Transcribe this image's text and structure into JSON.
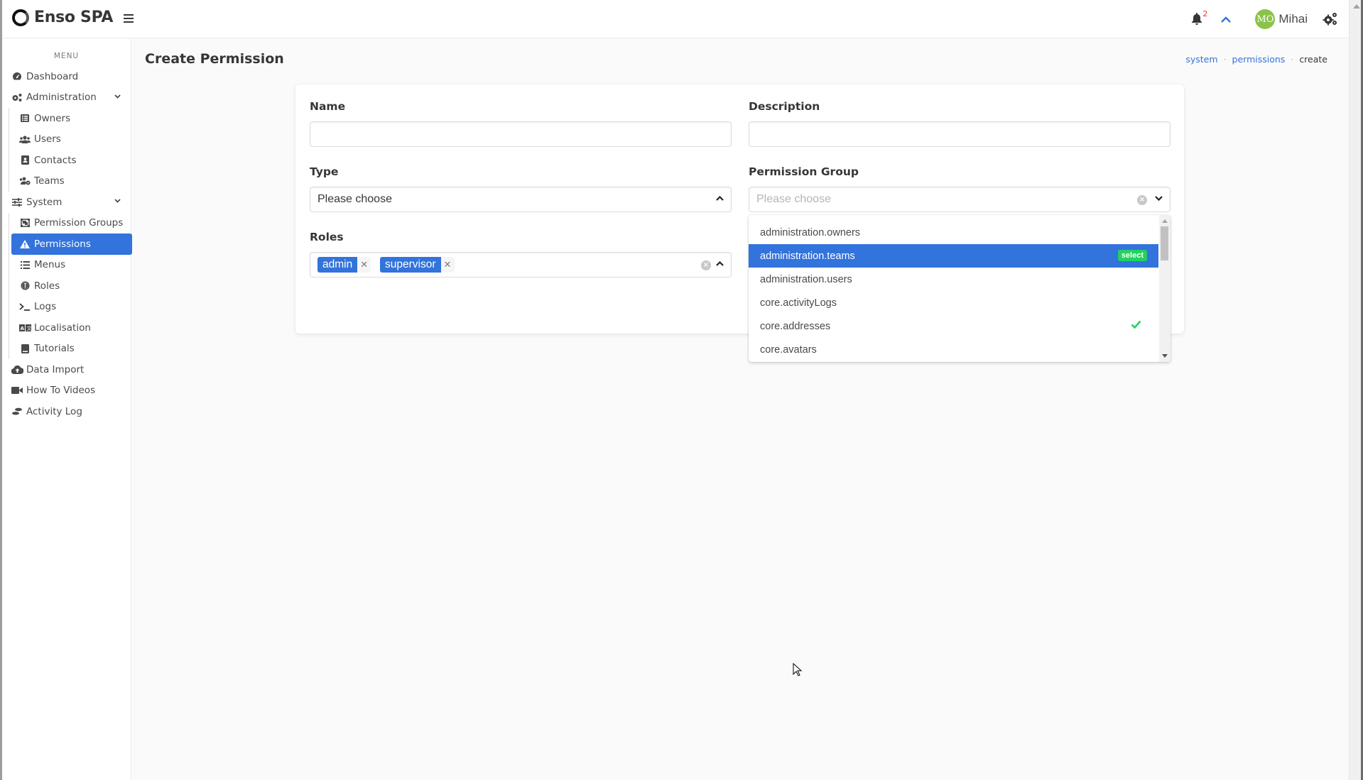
{
  "app": {
    "title": "Enso SPA"
  },
  "header": {
    "notifications_count": "2",
    "user": {
      "initials": "MO",
      "name": "Mihai"
    },
    "colors": {
      "avatar": "#8bc34a",
      "accent": "#3273dc",
      "badge": "#ff2b2b"
    }
  },
  "sidebar": {
    "menu_label": "MENU",
    "items": [
      {
        "label": "Dashboard",
        "icon": "tachometer-icon"
      },
      {
        "label": "Administration",
        "icon": "cogs-icon",
        "expanded": true,
        "children": [
          {
            "label": "Owners",
            "icon": "table-list-icon"
          },
          {
            "label": "Users",
            "icon": "users-icon"
          },
          {
            "label": "Contacts",
            "icon": "address-card-icon"
          },
          {
            "label": "Teams",
            "icon": "users-cog-icon"
          }
        ]
      },
      {
        "label": "System",
        "icon": "sliders-icon",
        "expanded": true,
        "children": [
          {
            "label": "Permission Groups",
            "icon": "object-group-icon"
          },
          {
            "label": "Permissions",
            "icon": "warning-icon",
            "active": true
          },
          {
            "label": "Menus",
            "icon": "list-icon"
          },
          {
            "label": "Roles",
            "icon": "user-circle-icon"
          },
          {
            "label": "Logs",
            "icon": "terminal-icon"
          },
          {
            "label": "Localisation",
            "icon": "language-icon"
          },
          {
            "label": "Tutorials",
            "icon": "book-icon"
          }
        ]
      },
      {
        "label": "Data Import",
        "icon": "cloud-upload-icon"
      },
      {
        "label": "How To Videos",
        "icon": "video-icon"
      },
      {
        "label": "Activity Log",
        "icon": "shoe-prints-icon"
      }
    ]
  },
  "page": {
    "title": "Create Permission",
    "breadcrumb": [
      {
        "label": "system",
        "link": true
      },
      {
        "label": "permissions",
        "link": true
      },
      {
        "label": "create",
        "link": false
      }
    ]
  },
  "form": {
    "name": {
      "label": "Name",
      "value": ""
    },
    "description": {
      "label": "Description",
      "value": ""
    },
    "type": {
      "label": "Type",
      "value": "Please choose"
    },
    "permission_group": {
      "label": "Permission Group",
      "placeholder": "Please choose",
      "open": true,
      "options": [
        {
          "label": "administration.owners"
        },
        {
          "label": "administration.teams",
          "highlighted": true,
          "badge": "select"
        },
        {
          "label": "administration.users"
        },
        {
          "label": "core.activityLogs"
        },
        {
          "label": "core.addresses",
          "selected": true
        },
        {
          "label": "core.avatars"
        }
      ]
    },
    "roles": {
      "label": "Roles",
      "tags": [
        "admin",
        "supervisor"
      ]
    }
  }
}
